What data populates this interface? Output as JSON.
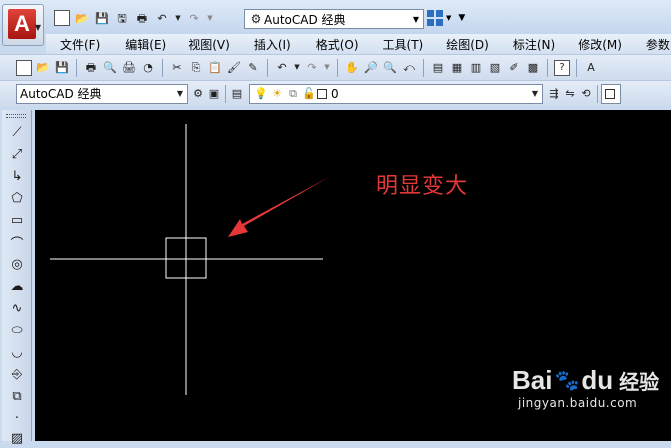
{
  "app": {
    "logo_letter": "A",
    "workspace": "AutoCAD 经典"
  },
  "quick_access": [
    "new-icon",
    "open-icon",
    "save-icon",
    "saveas-icon",
    "print-icon",
    "undo-icon",
    "redo-icon"
  ],
  "menu": [
    {
      "label": "文件(F)"
    },
    {
      "label": "编辑(E)"
    },
    {
      "label": "视图(V)"
    },
    {
      "label": "插入(I)"
    },
    {
      "label": "格式(O)"
    },
    {
      "label": "工具(T)"
    },
    {
      "label": "绘图(D)"
    },
    {
      "label": "标注(N)"
    },
    {
      "label": "修改(M)"
    },
    {
      "label": "参数(P)"
    }
  ],
  "toolbar2": {
    "workspace_select": "AutoCAD 经典",
    "layer_select": "0"
  },
  "canvas": {
    "annotation": "明显变大",
    "annotation_color": "#e53737",
    "crosshair_color": "#ffffff"
  },
  "watermark": {
    "brand": "Bai",
    "brand2": "du",
    "cn": "经验",
    "url": "jingyan.baidu.com"
  }
}
